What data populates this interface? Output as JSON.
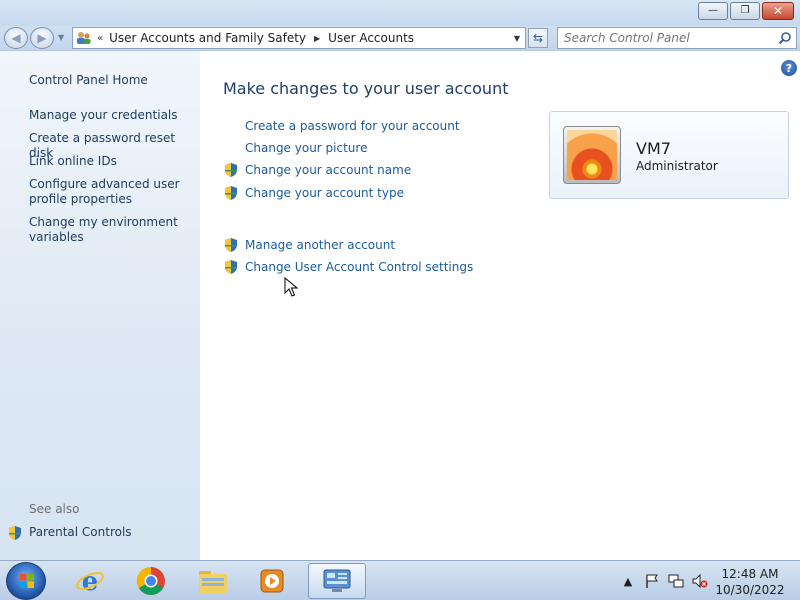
{
  "window": {
    "minimize_glyph": "—",
    "maximize_glyph": "❐",
    "close_glyph": "✕"
  },
  "nav": {
    "back_glyph": "◀",
    "forward_glyph": "▶",
    "address_chevron": "«",
    "breadcrumbs": [
      "User Accounts and Family Safety",
      "User Accounts"
    ],
    "breadcrumb_separator": "▶",
    "search_placeholder": "Search Control Panel",
    "refresh_glyph": "⇆"
  },
  "sidebar": {
    "home": "Control Panel Home",
    "links": [
      "Manage your credentials",
      "Create a password reset disk",
      "Link online IDs",
      "Configure advanced user profile properties",
      "Change my environment variables"
    ],
    "see_also_label": "See also",
    "see_also": [
      "Parental Controls"
    ]
  },
  "main": {
    "title": "Make changes to your user account",
    "tasks_group1": [
      {
        "label": "Create a password for your account",
        "shield": false
      },
      {
        "label": "Change your picture",
        "shield": false
      },
      {
        "label": "Change your account name",
        "shield": true
      },
      {
        "label": "Change your account type",
        "shield": true
      }
    ],
    "tasks_group2": [
      {
        "label": "Manage another account",
        "shield": true
      },
      {
        "label": "Change User Account Control settings",
        "shield": true
      }
    ],
    "help_glyph": "?"
  },
  "user": {
    "name": "VM7",
    "role": "Administrator"
  },
  "taskbar": {
    "clock_time": "12:48 AM",
    "clock_date": "10/30/2022",
    "tray_arrow": "▲"
  },
  "colors": {
    "link": "#1a5b9a",
    "title": "#1e3e6b",
    "sidebar_text": "#1e3a5c"
  }
}
